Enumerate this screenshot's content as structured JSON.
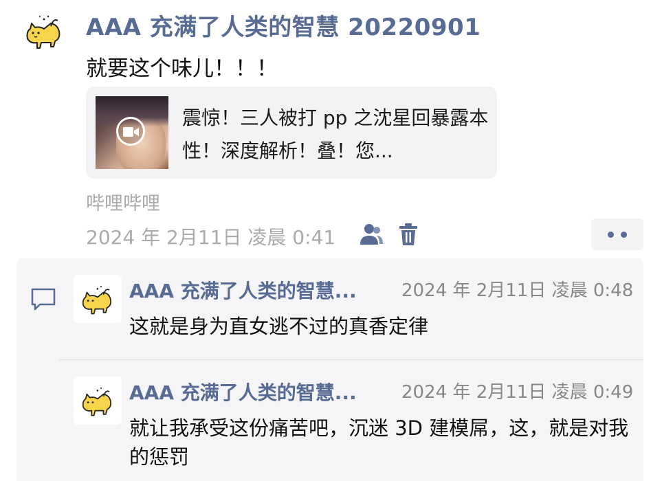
{
  "post": {
    "author": "AAA 充满了人类的智慧 20220901",
    "text": "就要这个味儿！！！",
    "avatar_icon": "cat-avatar-icon",
    "link_card": {
      "title": "震惊！三人被打 pp 之沈星回暴露本性！深度解析！叠！您...",
      "thumbnail_icon": "video-play-icon"
    },
    "source": "哔哩哔哩",
    "time": "2024 年 2月11日 凌晨 0:41",
    "visibility_icon": "friends-icon",
    "delete_icon": "trash-icon",
    "more_icon": "more-dots-icon"
  },
  "comments": [
    {
      "author": "AAA 充满了人类的智慧...",
      "time": "2024 年 2月11日 凌晨 0:48",
      "text": "这就是身为直女逃不过的真香定律"
    },
    {
      "author": "AAA 充满了人类的智慧...",
      "time": "2024 年 2月11日 凌晨 0:49",
      "text": "就让我承受这份痛苦吧，沉迷 3D 建模屌，这，就是对我的惩罚"
    }
  ],
  "colors": {
    "link_blue": "#576b95",
    "muted_gray": "#aaaaaa",
    "panel_bg": "#f5f5f7",
    "avatar_yellow": "#f7d54a"
  }
}
